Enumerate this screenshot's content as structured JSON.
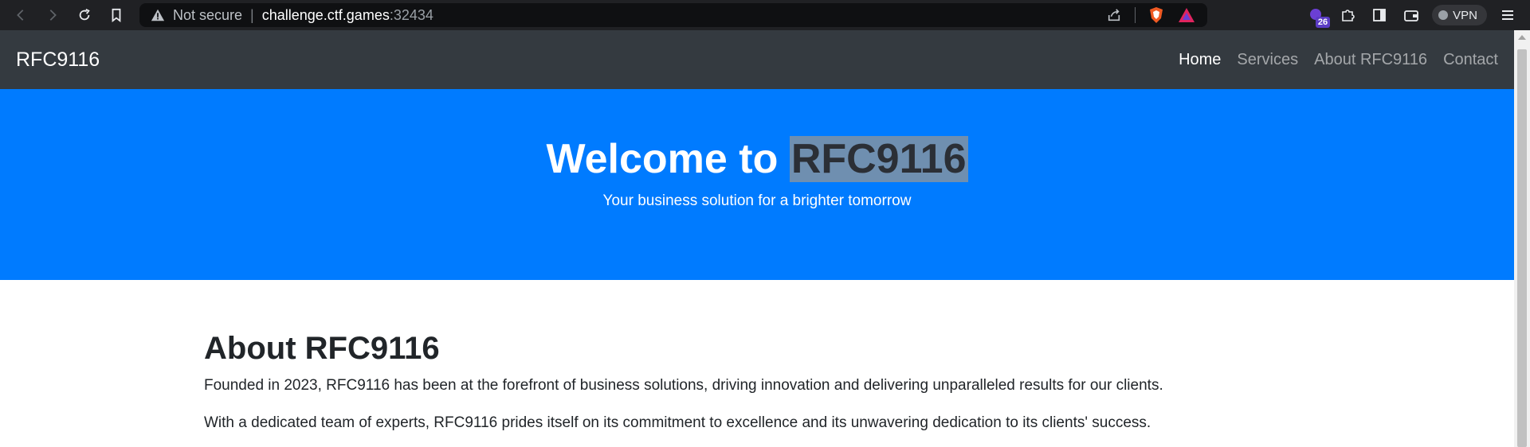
{
  "browser": {
    "security_label": "Not secure",
    "host": "challenge.ctf.games",
    "port": ":32434",
    "extension_badge": "26",
    "vpn_label": "VPN",
    "icons": [
      "back-icon",
      "forward-icon",
      "reload-icon",
      "bookmark-icon",
      "warning-icon",
      "share-icon",
      "brave-shields-icon",
      "brave-rewards-icon",
      "extension-icon",
      "puzzle-icon",
      "sidebar-icon",
      "wallet-icon",
      "menu-icon"
    ]
  },
  "navbar": {
    "brand": "RFC9116",
    "links": [
      {
        "label": "Home",
        "active": true
      },
      {
        "label": "Services",
        "active": false
      },
      {
        "label": "About RFC9116",
        "active": false
      },
      {
        "label": "Contact",
        "active": false
      }
    ]
  },
  "hero": {
    "title_prefix": "Welcome to ",
    "title_selected": "RFC9116",
    "subtitle": "Your business solution for a brighter tomorrow"
  },
  "about": {
    "heading": "About RFC9116",
    "paragraphs": [
      "Founded in 2023, RFC9116 has been at the forefront of business solutions, driving innovation and delivering unparalleled results for our clients.",
      "With a dedicated team of experts, RFC9116 prides itself on its commitment to excellence and its unwavering dedication to its clients' success."
    ]
  },
  "colors": {
    "navbar_bg": "#343a40",
    "hero_bg": "#007bff",
    "selection_bg": "#6f8fb0"
  }
}
